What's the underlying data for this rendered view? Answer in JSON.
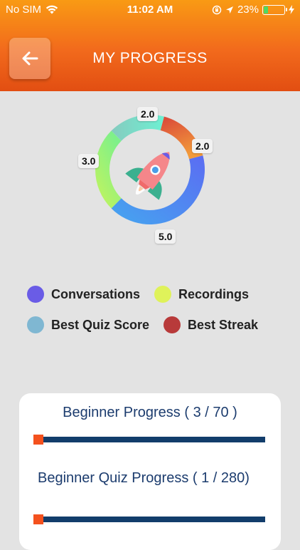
{
  "status_bar": {
    "carrier": "No SIM",
    "time": "11:02 AM",
    "battery": "23%",
    "battery_level": 0.23
  },
  "header": {
    "title": "MY PROGRESS",
    "back_icon": "arrow-left-icon",
    "gradient_colors": [
      "#f99a14",
      "#e24e12"
    ]
  },
  "chart_data": {
    "type": "pie",
    "style": "donut",
    "center_image": "rocket-icon",
    "values": [
      {
        "label": "Conversations",
        "value": 5.0,
        "color": "#5b6cf2"
      },
      {
        "label": "Recordings",
        "value": 3.0,
        "color": "#a9f25c"
      },
      {
        "label": "Best Quiz Score",
        "value": 2.0,
        "color": "#7fd8c6"
      },
      {
        "label": "Best Streak",
        "value": 2.0,
        "color": "#d9563a"
      }
    ],
    "data_labels": [
      "5.0",
      "3.0",
      "2.0",
      "2.0"
    ]
  },
  "legend": [
    {
      "label": "Conversations",
      "color": "#6a5ce6"
    },
    {
      "label": "Recordings",
      "color": "#dff25a"
    },
    {
      "label": "Best Quiz Score",
      "color": "#7fb7d2"
    },
    {
      "label": "Best Streak",
      "color": "#b83a3a"
    }
  ],
  "progress": [
    {
      "title": "Beginner Progress ( 3 / 70 )",
      "current": 3,
      "total": 70
    },
    {
      "title": "Beginner Quiz Progress ( 1 / 280)",
      "current": 1,
      "total": 280
    }
  ]
}
